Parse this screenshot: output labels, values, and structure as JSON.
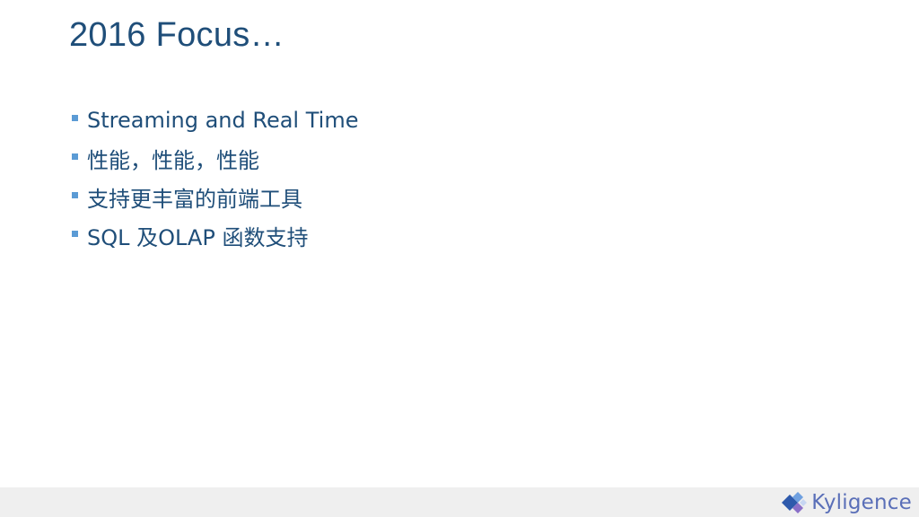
{
  "slide": {
    "title": "2016 Focus…",
    "bullets": [
      {
        "text": "Streaming and Real Time"
      },
      {
        "text": "性能，性能，性能"
      },
      {
        "text": "支持更丰富的前端工具"
      },
      {
        "text": "SQL 及OLAP 函数支持"
      }
    ]
  },
  "footer": {
    "logo_text": "Kyligence",
    "logo_icon": "kyligence-diamond-icon"
  },
  "colors": {
    "title": "#1f4e79",
    "bullet_marker": "#5b9bd5",
    "footer_bg": "#efefef",
    "logo_text": "#5a6fb8",
    "logo_blue": "#2e5aac",
    "logo_light": "#6fa0e0",
    "logo_purple": "#8a6fc8"
  }
}
